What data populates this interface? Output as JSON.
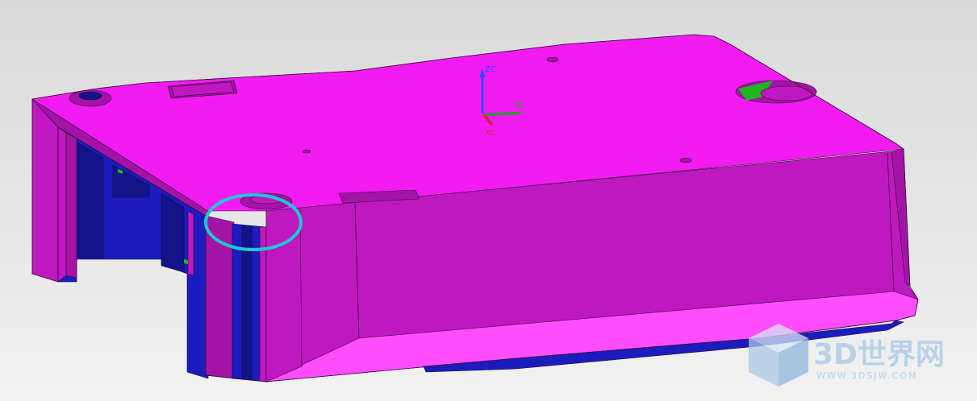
{
  "viewport": {
    "background_top": "#d9d9d9",
    "background_bottom": "#f2f2f2"
  },
  "model": {
    "top_face_color": "#f21cf2",
    "side_face_color": "#bf18c0",
    "dark_side_color": "#a314a6",
    "cavity_color": "#1c1cbe",
    "highlight_color": "#ff4dff",
    "green_detail_color": "#1fb51f",
    "edge_color": "#3a0a3e"
  },
  "triad": {
    "zc": "ZC",
    "yc": "YC",
    "xc": "XC",
    "zc_color": "#2a4cff",
    "yc_color": "#1aa31a",
    "xc_color": "#e0182a"
  },
  "annotation": {
    "circle_color": "#1ec8d0"
  },
  "watermark": {
    "brand": "3D世界网",
    "url": "WWW.3DSJW.COM",
    "color": "#a9c8e6"
  }
}
